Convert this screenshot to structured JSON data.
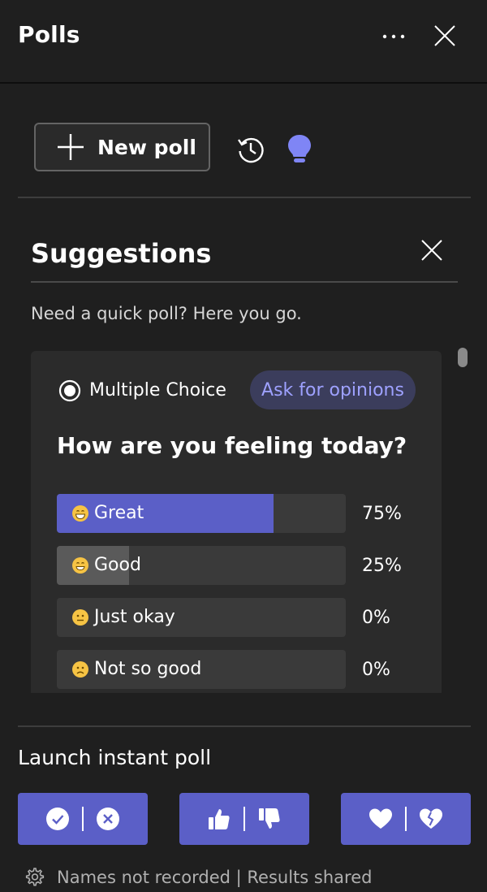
{
  "header": {
    "title": "Polls"
  },
  "toolbar": {
    "new_poll_label": "New poll"
  },
  "suggestions": {
    "title": "Suggestions",
    "subtitle": "Need a quick poll? Here you go."
  },
  "poll": {
    "type_label": "Multiple Choice",
    "opinion_label": "Ask for opinions",
    "question": "How are you feeling today?",
    "options": [
      {
        "label": "Great",
        "percent_text": "75%",
        "fraction": 0.75
      },
      {
        "label": "Good",
        "percent_text": "25%",
        "fraction": 0.25
      },
      {
        "label": "Just okay",
        "percent_text": "0%",
        "fraction": 0.0
      },
      {
        "label": "Not so good",
        "percent_text": "0%",
        "fraction": 0.0
      }
    ]
  },
  "instant": {
    "heading": "Launch instant poll",
    "buttons": [
      {
        "icons": [
          "check-circle-icon",
          "x-circle-icon"
        ]
      },
      {
        "icons": [
          "thumbs-up-icon",
          "thumbs-down-icon"
        ]
      },
      {
        "icons": [
          "heart-icon",
          "broken-heart-icon"
        ]
      }
    ]
  },
  "footer": {
    "text": "Names not recorded | Results shared"
  },
  "colors": {
    "background": "#1f1f1f",
    "accent": "#5b5fc7",
    "accent_text": "#9ea1ff",
    "winner_fill": "#5b5fc7",
    "other_fill": "#5a5a5a",
    "track": "#3a3a3a"
  }
}
